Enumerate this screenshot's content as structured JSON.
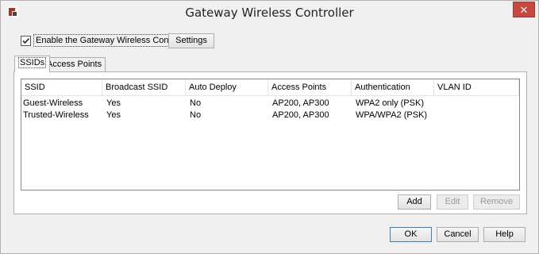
{
  "window": {
    "title": "Gateway Wireless Controller",
    "close_glyph": "✕"
  },
  "enable": {
    "label": "Enable the Gateway Wireless Controller",
    "checked": true
  },
  "settings_label": "Settings",
  "tabs": [
    {
      "label": "SSIDs",
      "active": true
    },
    {
      "label": "Access Points",
      "active": false
    }
  ],
  "table": {
    "columns": [
      "SSID",
      "Broadcast SSID",
      "Auto Deploy",
      "Access Points",
      "Authentication",
      "VLAN ID"
    ],
    "rows": [
      [
        "Guest-Wireless",
        "Yes",
        "No",
        "AP200, AP300",
        "WPA2 only (PSK)",
        ""
      ],
      [
        "Trusted-Wireless",
        "Yes",
        "No",
        "AP200, AP300",
        "WPA/WPA2 (PSK)",
        ""
      ]
    ]
  },
  "panel_buttons": {
    "add": "Add",
    "edit": "Edit",
    "remove": "Remove"
  },
  "footer_buttons": {
    "ok": "OK",
    "cancel": "Cancel",
    "help": "Help"
  },
  "colors": {
    "close": "#c7463d",
    "app_icon": "#b52a22",
    "default_border": "#3c7fb1"
  }
}
